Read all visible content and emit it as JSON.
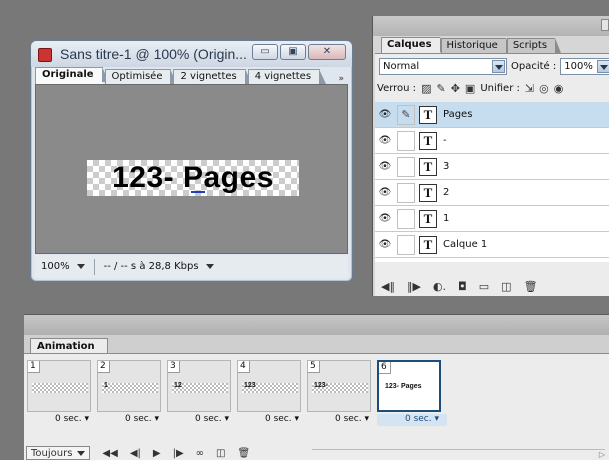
{
  "document": {
    "title": "Sans titre-1 @ 100% (Origin...",
    "window_buttons": {
      "minimize": "▭",
      "restore": "▣",
      "close": "✕"
    },
    "tabs": [
      "Originale",
      "Optimisée",
      "2 vignettes",
      "4 vignettes"
    ],
    "tabs_more": "»",
    "preview_text": "123- Pages",
    "zoom": "100%",
    "status_text": "-- / -- s à 28,8 Kbps"
  },
  "layers_panel": {
    "tabs": [
      "Calques",
      "Historique",
      "Scripts"
    ],
    "blend_mode": "Normal",
    "opacity_label": "Opacité :",
    "opacity_value": "100%",
    "lock_label": "Verrou :",
    "unify_label": "Unifier :",
    "layers": [
      {
        "name": "Pages",
        "selected": true
      },
      {
        "name": "-",
        "selected": false
      },
      {
        "name": "3",
        "selected": false
      },
      {
        "name": "2",
        "selected": false
      },
      {
        "name": "1",
        "selected": false
      },
      {
        "name": "Calque 1",
        "selected": false
      }
    ],
    "layer_type_glyph": "T",
    "eye_glyph": "👁",
    "brush_glyph": "✎"
  },
  "animation_panel": {
    "tab": "Animation",
    "frames": [
      {
        "num": "1",
        "thumb": "",
        "delay": "0 sec. ▾",
        "selected": false
      },
      {
        "num": "2",
        "thumb": "1",
        "delay": "0 sec. ▾",
        "selected": false
      },
      {
        "num": "3",
        "thumb": "12",
        "delay": "0 sec. ▾",
        "selected": false
      },
      {
        "num": "4",
        "thumb": "123",
        "delay": "0 sec. ▾",
        "selected": false
      },
      {
        "num": "5",
        "thumb": "123-",
        "delay": "0 sec. ▾",
        "selected": false
      },
      {
        "num": "6",
        "thumb": "123- Pages",
        "delay": "0 sec. ▾",
        "selected": true
      }
    ],
    "loop_value": "Toujours"
  },
  "colors": {
    "app_bg": "#787878",
    "selection": "#c6ddf0",
    "frame_selected_border": "#1d4d7c"
  }
}
